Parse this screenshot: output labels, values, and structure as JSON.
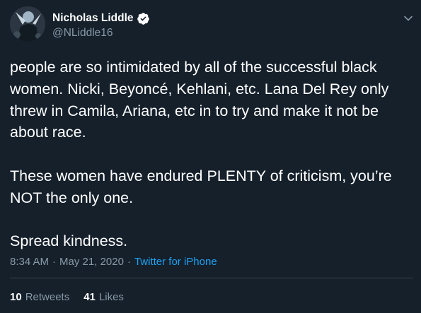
{
  "tweet": {
    "author": {
      "display_name": "Nicholas Liddle",
      "handle": "@NLiddle16",
      "verified": true,
      "verified_color": "#ffffff"
    },
    "paragraphs": [
      "people are so intimidated by all of the successful black women. Nicki, Beyoncé, Kehlani, etc. Lana Del Rey only threw in Camila, Ariana, etc in to try and make it not be about race.",
      "These women have endured PLENTY of criticism, you’re NOT the only one.",
      "Spread kindness."
    ],
    "meta": {
      "time": "8:34 AM",
      "separator": "·",
      "date": "May 21, 2020",
      "source": "Twitter for iPhone"
    },
    "stats": {
      "retweets_count": "10",
      "retweets_label": "Retweets",
      "likes_count": "41",
      "likes_label": "Likes"
    },
    "icons": {
      "verified": "verified-badge-icon",
      "menu": "chevron-down-icon"
    },
    "colors": {
      "background": "#15202b",
      "text": "#ffffff",
      "secondary_text": "#8899a6",
      "link": "#1da1f2",
      "divider": "#38444d"
    }
  }
}
